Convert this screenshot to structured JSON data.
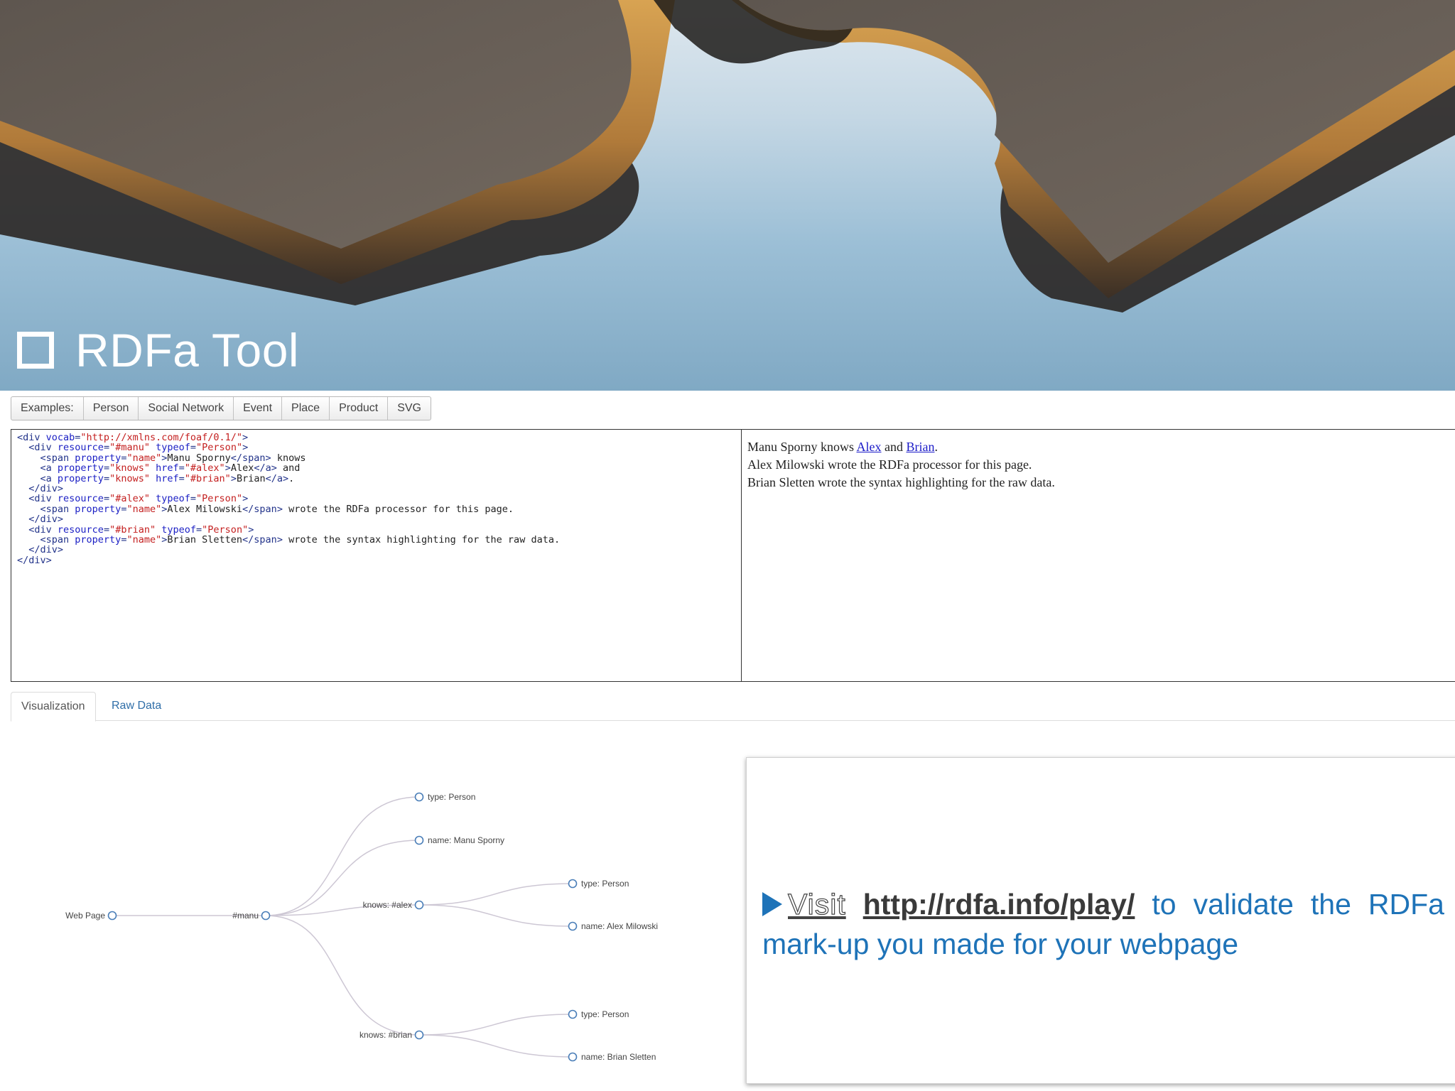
{
  "slide": {
    "title": "RDFa Tool"
  },
  "toolbar": {
    "items": [
      "Examples:",
      "Person",
      "Social Network",
      "Event",
      "Place",
      "Product",
      "SVG"
    ]
  },
  "code": {
    "lines": [
      [
        [
          "tg",
          "<div "
        ],
        [
          "at",
          "vocab"
        ],
        [
          "tg",
          "="
        ],
        [
          "av",
          "\"http://xmlns.com/foaf/0.1/\""
        ],
        [
          "tg",
          ">"
        ]
      ],
      [
        [
          "tg",
          "  <div "
        ],
        [
          "at",
          "resource"
        ],
        [
          "tg",
          "="
        ],
        [
          "av",
          "\"#manu\""
        ],
        [
          "tg",
          " "
        ],
        [
          "at",
          "typeof"
        ],
        [
          "tg",
          "="
        ],
        [
          "av",
          "\"Person\""
        ],
        [
          "tg",
          ">"
        ]
      ],
      [
        [
          "tg",
          "    <span "
        ],
        [
          "at",
          "property"
        ],
        [
          "tg",
          "="
        ],
        [
          "av",
          "\"name\""
        ],
        [
          "tg",
          ">"
        ],
        [
          "tx",
          "Manu Sporny"
        ],
        [
          "tg",
          "</span>"
        ],
        [
          "tx",
          " knows"
        ]
      ],
      [
        [
          "tg",
          "    <a "
        ],
        [
          "at",
          "property"
        ],
        [
          "tg",
          "="
        ],
        [
          "av",
          "\"knows\""
        ],
        [
          "tg",
          " "
        ],
        [
          "at",
          "href"
        ],
        [
          "tg",
          "="
        ],
        [
          "av",
          "\"#alex\""
        ],
        [
          "tg",
          ">"
        ],
        [
          "tx",
          "Alex"
        ],
        [
          "tg",
          "</a>"
        ],
        [
          "tx",
          " and"
        ]
      ],
      [
        [
          "tg",
          "    <a "
        ],
        [
          "at",
          "property"
        ],
        [
          "tg",
          "="
        ],
        [
          "av",
          "\"knows\""
        ],
        [
          "tg",
          " "
        ],
        [
          "at",
          "href"
        ],
        [
          "tg",
          "="
        ],
        [
          "av",
          "\"#brian\""
        ],
        [
          "tg",
          ">"
        ],
        [
          "tx",
          "Brian"
        ],
        [
          "tg",
          "</a>"
        ],
        [
          "tx",
          "."
        ]
      ],
      [
        [
          "tg",
          "  </div>"
        ]
      ],
      [
        [
          "tg",
          "  <div "
        ],
        [
          "at",
          "resource"
        ],
        [
          "tg",
          "="
        ],
        [
          "av",
          "\"#alex\""
        ],
        [
          "tg",
          " "
        ],
        [
          "at",
          "typeof"
        ],
        [
          "tg",
          "="
        ],
        [
          "av",
          "\"Person\""
        ],
        [
          "tg",
          ">"
        ]
      ],
      [
        [
          "tg",
          "    <span "
        ],
        [
          "at",
          "property"
        ],
        [
          "tg",
          "="
        ],
        [
          "av",
          "\"name\""
        ],
        [
          "tg",
          ">"
        ],
        [
          "tx",
          "Alex Milowski"
        ],
        [
          "tg",
          "</span>"
        ],
        [
          "tx",
          " wrote the RDFa processor for this page."
        ]
      ],
      [
        [
          "tg",
          "  </div>"
        ]
      ],
      [
        [
          "tg",
          "  <div "
        ],
        [
          "at",
          "resource"
        ],
        [
          "tg",
          "="
        ],
        [
          "av",
          "\"#brian\""
        ],
        [
          "tg",
          " "
        ],
        [
          "at",
          "typeof"
        ],
        [
          "tg",
          "="
        ],
        [
          "av",
          "\"Person\""
        ],
        [
          "tg",
          ">"
        ]
      ],
      [
        [
          "tg",
          "    <span "
        ],
        [
          "at",
          "property"
        ],
        [
          "tg",
          "="
        ],
        [
          "av",
          "\"name\""
        ],
        [
          "tg",
          ">"
        ],
        [
          "tx",
          "Brian Sletten"
        ],
        [
          "tg",
          "</span>"
        ],
        [
          "tx",
          " wrote the syntax highlighting for the raw data."
        ]
      ],
      [
        [
          "tg",
          "  </div>"
        ]
      ],
      [
        [
          "tg",
          "</div>"
        ]
      ]
    ]
  },
  "preview": {
    "line1_pre": "Manu Sporny knows ",
    "line1_link1": "Alex",
    "line1_mid": " and ",
    "line1_link2": "Brian",
    "line1_post": ".",
    "line2": "Alex Milowski wrote the RDFa processor for this page.",
    "line3": "Brian Sletten wrote the syntax highlighting for the raw data."
  },
  "tabs": {
    "visualization": "Visualization",
    "raw_data": "Raw Data"
  },
  "tree": {
    "root": "Web Page",
    "manu": "#manu",
    "manu_type": "type: Person",
    "manu_name": "name: Manu Sporny",
    "knows_alex": "knows: #alex",
    "alex_type": "type: Person",
    "alex_name": "name: Alex Milowski",
    "knows_brian": "knows: #brian",
    "brian_type": "type: Person",
    "brian_name": "name: Brian Sletten"
  },
  "callout": {
    "visit": "Visit",
    "url": "http://rdfa.info/play/",
    "rest": " to validate the RDFa mark-up you made for your webpage"
  },
  "colors": {
    "accent_blue": "#1e73b8",
    "node_stroke": "#4a7eb8",
    "link_blue": "#1a1ac8"
  }
}
